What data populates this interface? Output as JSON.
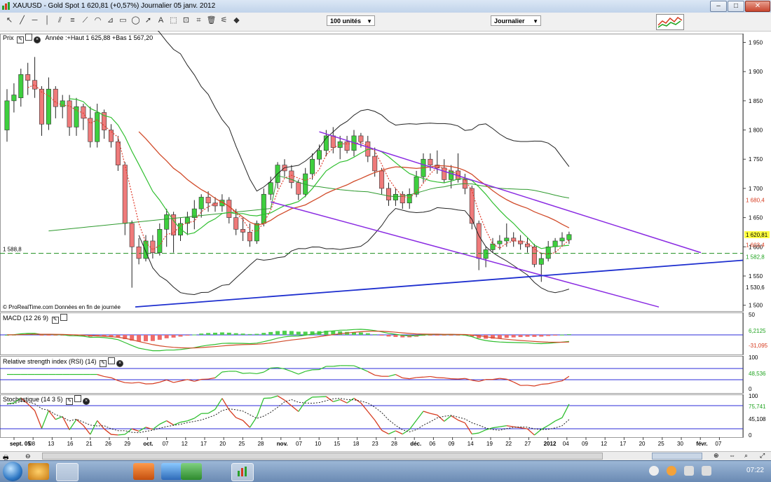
{
  "window": {
    "title": "XAUUSD - Gold Spot   1 620,81 (+0,57%)   Journalier  05 janv. 2012",
    "buttons": {
      "minimize": "–",
      "maximize": "□",
      "close": "✕"
    }
  },
  "toolbar": {
    "units_select": "100 unités",
    "period_select": "Journalier"
  },
  "price_panel": {
    "label": "Prix",
    "year_info": "Année :+Haut 1 625,88 +Bas 1 567,20",
    "hline_label": "1 588,8",
    "footer": "© ProRealTime.com  Données en fin de journée",
    "yticks": [
      "1 950",
      "1 900",
      "1 850",
      "1 800",
      "1 750",
      "1 700",
      "1 650",
      "1 600",
      "1 550",
      "1 500"
    ],
    "right_labels": [
      {
        "text": "1 680,4",
        "color": "#d63a1e"
      },
      {
        "text": "1 620,81",
        "color": "#000000",
        "bg": "#ffff40"
      },
      {
        "text": "1 603,4",
        "color": "#d63a1e"
      },
      {
        "text": "1 582,8",
        "color": "#1fa31f"
      },
      {
        "text": "1 530,6",
        "color": "#000000"
      }
    ]
  },
  "macd_panel": {
    "label": "MACD (12 26 9)",
    "yticks": [
      "50",
      "6,2125",
      "-31,095"
    ]
  },
  "rsi_panel": {
    "label": "Relative strength index (RSI) (14)",
    "yticks": [
      "100",
      "48,536",
      "0"
    ]
  },
  "stoch_panel": {
    "label": "Stochastique (14 3 5)",
    "yticks": [
      "100",
      "75,741",
      "45,108",
      "0"
    ]
  },
  "x_axis": {
    "labels": [
      "sept. 05",
      "08",
      "13",
      "16",
      "21",
      "26",
      "29",
      "oct.",
      "07",
      "12",
      "17",
      "20",
      "25",
      "28",
      "nov.",
      "07",
      "10",
      "15",
      "18",
      "23",
      "28",
      "déc.",
      "06",
      "09",
      "14",
      "19",
      "22",
      "27",
      "2012",
      "04",
      "09",
      "12",
      "17",
      "20",
      "25",
      "30",
      "févr.",
      "07"
    ]
  },
  "taskbar": {
    "clock": "07:22"
  },
  "chart_data": {
    "type": "candlestick",
    "title": "XAUUSD - Gold Spot",
    "ylim": [
      1490,
      1965
    ],
    "candles": [
      [
        1800,
        1870,
        1780,
        1850
      ],
      [
        1850,
        1880,
        1830,
        1860
      ],
      [
        1855,
        1905,
        1840,
        1895
      ],
      [
        1895,
        1915,
        1860,
        1885
      ],
      [
        1885,
        1925,
        1855,
        1870
      ],
      [
        1870,
        1875,
        1790,
        1810
      ],
      [
        1810,
        1890,
        1800,
        1870
      ],
      [
        1870,
        1875,
        1820,
        1840
      ],
      [
        1840,
        1860,
        1820,
        1850
      ],
      [
        1850,
        1860,
        1790,
        1805
      ],
      [
        1805,
        1855,
        1790,
        1840
      ],
      [
        1840,
        1845,
        1800,
        1820
      ],
      [
        1820,
        1840,
        1770,
        1780
      ],
      [
        1780,
        1845,
        1770,
        1830
      ],
      [
        1830,
        1835,
        1785,
        1800
      ],
      [
        1800,
        1810,
        1770,
        1780
      ],
      [
        1780,
        1790,
        1730,
        1740
      ],
      [
        1740,
        1745,
        1620,
        1640
      ],
      [
        1640,
        1645,
        1530,
        1600
      ],
      [
        1600,
        1615,
        1570,
        1580
      ],
      [
        1580,
        1620,
        1575,
        1610
      ],
      [
        1610,
        1620,
        1580,
        1590
      ],
      [
        1590,
        1640,
        1585,
        1630
      ],
      [
        1630,
        1665,
        1600,
        1655
      ],
      [
        1655,
        1660,
        1590,
        1620
      ],
      [
        1620,
        1650,
        1610,
        1640
      ],
      [
        1640,
        1660,
        1620,
        1650
      ],
      [
        1650,
        1680,
        1630,
        1665
      ],
      [
        1665,
        1690,
        1650,
        1685
      ],
      [
        1685,
        1695,
        1660,
        1675
      ],
      [
        1675,
        1685,
        1660,
        1670
      ],
      [
        1670,
        1690,
        1660,
        1680
      ],
      [
        1680,
        1685,
        1640,
        1650
      ],
      [
        1650,
        1665,
        1620,
        1630
      ],
      [
        1630,
        1650,
        1610,
        1625
      ],
      [
        1625,
        1640,
        1600,
        1610
      ],
      [
        1610,
        1645,
        1605,
        1640
      ],
      [
        1640,
        1700,
        1635,
        1690
      ],
      [
        1690,
        1720,
        1680,
        1710
      ],
      [
        1710,
        1745,
        1700,
        1740
      ],
      [
        1740,
        1750,
        1720,
        1730
      ],
      [
        1730,
        1740,
        1700,
        1710
      ],
      [
        1710,
        1715,
        1680,
        1690
      ],
      [
        1690,
        1735,
        1685,
        1725
      ],
      [
        1725,
        1760,
        1715,
        1750
      ],
      [
        1750,
        1775,
        1740,
        1765
      ],
      [
        1765,
        1800,
        1755,
        1790
      ],
      [
        1790,
        1805,
        1760,
        1770
      ],
      [
        1770,
        1790,
        1750,
        1780
      ],
      [
        1780,
        1790,
        1760,
        1765
      ],
      [
        1765,
        1800,
        1755,
        1790
      ],
      [
        1790,
        1795,
        1770,
        1780
      ],
      [
        1780,
        1790,
        1745,
        1755
      ],
      [
        1755,
        1770,
        1720,
        1730
      ],
      [
        1730,
        1735,
        1690,
        1700
      ],
      [
        1700,
        1710,
        1670,
        1680
      ],
      [
        1680,
        1700,
        1670,
        1690
      ],
      [
        1690,
        1695,
        1665,
        1675
      ],
      [
        1675,
        1700,
        1665,
        1690
      ],
      [
        1690,
        1730,
        1685,
        1720
      ],
      [
        1720,
        1760,
        1710,
        1750
      ],
      [
        1750,
        1760,
        1730,
        1740
      ],
      [
        1740,
        1765,
        1725,
        1735
      ],
      [
        1735,
        1750,
        1710,
        1715
      ],
      [
        1715,
        1740,
        1700,
        1730
      ],
      [
        1730,
        1760,
        1710,
        1715
      ],
      [
        1715,
        1725,
        1690,
        1700
      ],
      [
        1700,
        1705,
        1630,
        1640
      ],
      [
        1640,
        1645,
        1560,
        1580
      ],
      [
        1580,
        1600,
        1565,
        1595
      ],
      [
        1595,
        1615,
        1590,
        1605
      ],
      [
        1605,
        1620,
        1595,
        1610
      ],
      [
        1610,
        1640,
        1600,
        1615
      ],
      [
        1615,
        1625,
        1600,
        1610
      ],
      [
        1610,
        1620,
        1595,
        1605
      ],
      [
        1605,
        1615,
        1590,
        1600
      ],
      [
        1600,
        1605,
        1565,
        1570
      ],
      [
        1570,
        1590,
        1540,
        1580
      ],
      [
        1580,
        1610,
        1575,
        1600
      ],
      [
        1600,
        1615,
        1590,
        1610
      ],
      [
        1610,
        1625,
        1600,
        1615
      ],
      [
        1612,
        1626,
        1605,
        1621
      ]
    ],
    "indicators": {
      "sma_fast_red_dotted": "moving average (dotted red)",
      "ema_red": "moving average (red)",
      "sma_green": "moving average (green)",
      "ma_long_green": "long moving average (green)",
      "bollinger": "Bollinger bands (black)"
    }
  }
}
